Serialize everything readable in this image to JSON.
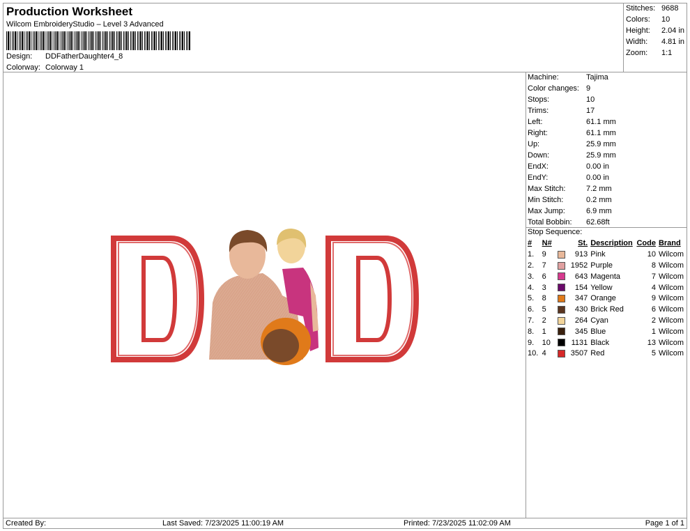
{
  "header": {
    "title": "Production Worksheet",
    "software": "Wilcom EmbroideryStudio – Level 3 Advanced",
    "design_label": "Design:",
    "design_value": "DDFatherDaughter4_8",
    "colorway_label": "Colorway:",
    "colorway_value": "Colorway 1"
  },
  "stats": [
    {
      "label": "Stitches:",
      "value": "9688"
    },
    {
      "label": "Colors:",
      "value": "10"
    },
    {
      "label": "Height:",
      "value": "2.04 in"
    },
    {
      "label": "Width:",
      "value": "4.81 in"
    },
    {
      "label": "Zoom:",
      "value": "1:1"
    }
  ],
  "info": [
    {
      "label": "Machine:",
      "value": "Tajima"
    },
    {
      "label": "Color changes:",
      "value": "9"
    },
    {
      "label": "Stops:",
      "value": "10"
    },
    {
      "label": "Trims:",
      "value": "17"
    },
    {
      "label": "Left:",
      "value": "61.1 mm"
    },
    {
      "label": "Right:",
      "value": "61.1 mm"
    },
    {
      "label": "Up:",
      "value": "25.9 mm"
    },
    {
      "label": "Down:",
      "value": "25.9 mm"
    },
    {
      "label": "EndX:",
      "value": "0.00 in"
    },
    {
      "label": "EndY:",
      "value": "0.00 in"
    },
    {
      "label": "Max Stitch:",
      "value": "7.2 mm"
    },
    {
      "label": "Min Stitch:",
      "value": "0.2 mm"
    },
    {
      "label": "Max Jump:",
      "value": "6.9 mm"
    },
    {
      "label": "Total Bobbin:",
      "value": "62.68ft"
    }
  ],
  "stop_sequence": {
    "title": "Stop Sequence:",
    "headers": [
      "#",
      "N#",
      "St.",
      "Description",
      "Code",
      "Brand"
    ],
    "rows": [
      {
        "idx": "1.",
        "n": "9",
        "color": "#e8b89a",
        "st": "913",
        "desc": "Pink",
        "code": "10",
        "brand": "Wilcom"
      },
      {
        "idx": "2.",
        "n": "7",
        "color": "#e0a0a0",
        "st": "1952",
        "desc": "Purple",
        "code": "8",
        "brand": "Wilcom"
      },
      {
        "idx": "3.",
        "n": "6",
        "color": "#d63a8e",
        "st": "643",
        "desc": "Magenta",
        "code": "7",
        "brand": "Wilcom"
      },
      {
        "idx": "4.",
        "n": "3",
        "color": "#6a0a6a",
        "st": "154",
        "desc": "Yellow",
        "code": "4",
        "brand": "Wilcom"
      },
      {
        "idx": "5.",
        "n": "8",
        "color": "#e07a1a",
        "st": "347",
        "desc": "Orange",
        "code": "9",
        "brand": "Wilcom"
      },
      {
        "idx": "6.",
        "n": "5",
        "color": "#5a3520",
        "st": "430",
        "desc": "Brick Red",
        "code": "6",
        "brand": "Wilcom"
      },
      {
        "idx": "7.",
        "n": "2",
        "color": "#f2d49a",
        "st": "264",
        "desc": "Cyan",
        "code": "2",
        "brand": "Wilcom"
      },
      {
        "idx": "8.",
        "n": "1",
        "color": "#3a200e",
        "st": "345",
        "desc": "Blue",
        "code": "1",
        "brand": "Wilcom"
      },
      {
        "idx": "9.",
        "n": "10",
        "color": "#000000",
        "st": "1131",
        "desc": "Black",
        "code": "13",
        "brand": "Wilcom"
      },
      {
        "idx": "10.",
        "n": "4",
        "color": "#d62828",
        "st": "3507",
        "desc": "Red",
        "code": "5",
        "brand": "Wilcom"
      }
    ]
  },
  "footer": {
    "created": "Created By:",
    "saved": "Last Saved: 7/23/2025 11:00:19 AM",
    "printed": "Printed: 7/23/2025 11:02:09 AM",
    "page": "Page 1 of 1"
  }
}
